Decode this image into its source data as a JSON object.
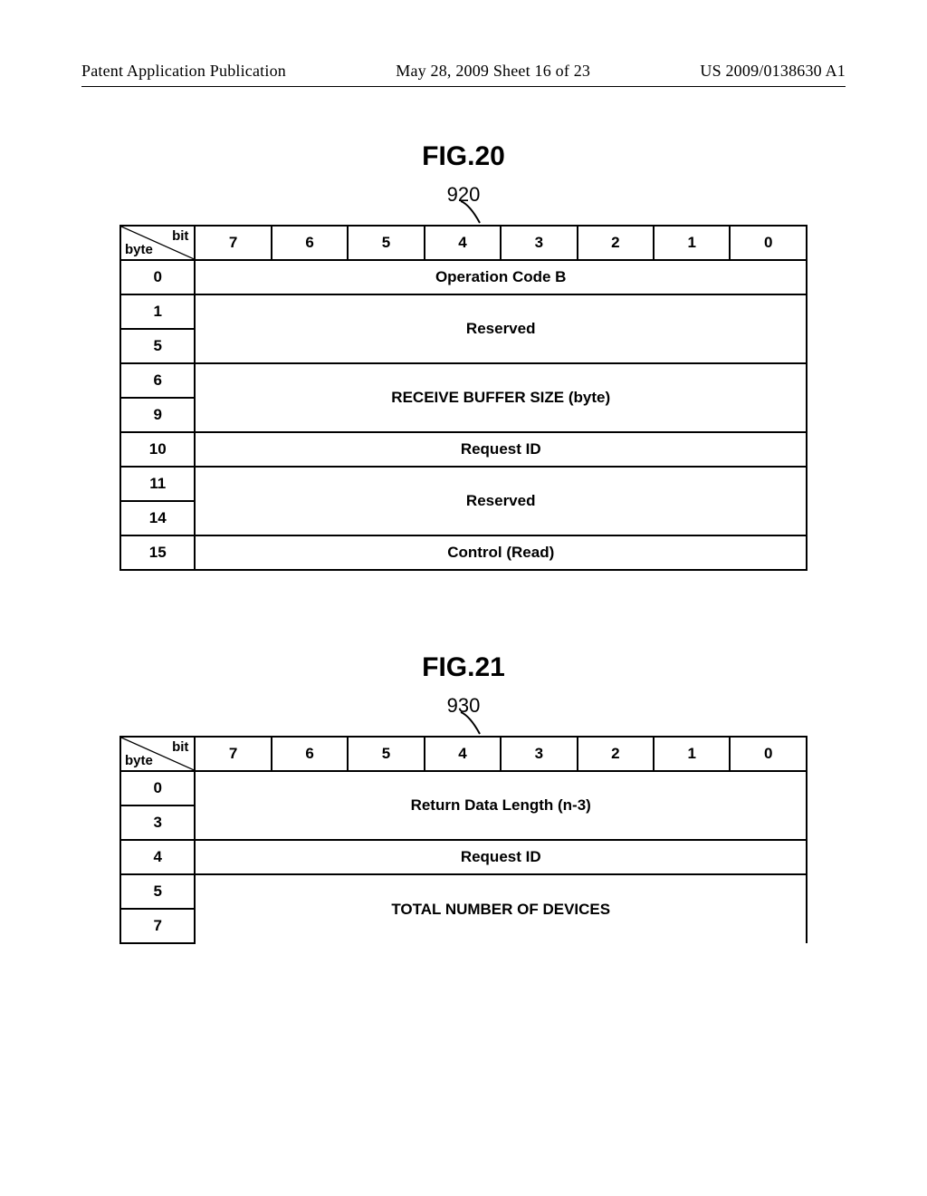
{
  "header": {
    "left": "Patent Application Publication",
    "center": "May 28, 2009  Sheet 16 of 23",
    "right": "US 2009/0138630 A1"
  },
  "fig20": {
    "title": "FIG.20",
    "ref": "920",
    "corner_bit": "bit",
    "corner_byte": "byte",
    "bits": [
      "7",
      "6",
      "5",
      "4",
      "3",
      "2",
      "1",
      "0"
    ],
    "rows": [
      {
        "type": "single",
        "byte": "0",
        "label": "Operation Code B"
      },
      {
        "type": "range",
        "from": "1",
        "to": "5",
        "label": "Reserved"
      },
      {
        "type": "range",
        "from": "6",
        "to": "9",
        "label": "RECEIVE BUFFER SIZE (byte)"
      },
      {
        "type": "single",
        "byte": "10",
        "label": "Request ID"
      },
      {
        "type": "range",
        "from": "11",
        "to": "14",
        "label": "Reserved"
      },
      {
        "type": "single",
        "byte": "15",
        "label": "Control (Read)"
      }
    ]
  },
  "fig21": {
    "title": "FIG.21",
    "ref": "930",
    "corner_bit": "bit",
    "corner_byte": "byte",
    "bits": [
      "7",
      "6",
      "5",
      "4",
      "3",
      "2",
      "1",
      "0"
    ],
    "rows": [
      {
        "type": "range",
        "from": "0",
        "to": "3",
        "label": "Return Data Length (n-3)"
      },
      {
        "type": "single",
        "byte": "4",
        "label": "Request ID"
      },
      {
        "type": "range",
        "from": "5",
        "to": "7",
        "label": "TOTAL NUMBER OF DEVICES"
      }
    ]
  },
  "chart_data": [
    {
      "type": "table",
      "title": "FIG.20 — command format 920",
      "columns_bit": [
        7,
        6,
        5,
        4,
        3,
        2,
        1,
        0
      ],
      "fields": [
        {
          "bytes": [
            0,
            0
          ],
          "name": "Operation Code B"
        },
        {
          "bytes": [
            1,
            5
          ],
          "name": "Reserved"
        },
        {
          "bytes": [
            6,
            9
          ],
          "name": "RECEIVE BUFFER SIZE (byte)"
        },
        {
          "bytes": [
            10,
            10
          ],
          "name": "Request ID"
        },
        {
          "bytes": [
            11,
            14
          ],
          "name": "Reserved"
        },
        {
          "bytes": [
            15,
            15
          ],
          "name": "Control (Read)"
        }
      ]
    },
    {
      "type": "table",
      "title": "FIG.21 — response format 930",
      "columns_bit": [
        7,
        6,
        5,
        4,
        3,
        2,
        1,
        0
      ],
      "fields": [
        {
          "bytes": [
            0,
            3
          ],
          "name": "Return Data Length (n-3)"
        },
        {
          "bytes": [
            4,
            4
          ],
          "name": "Request ID"
        },
        {
          "bytes": [
            5,
            7
          ],
          "name": "TOTAL NUMBER OF DEVICES"
        }
      ]
    }
  ]
}
